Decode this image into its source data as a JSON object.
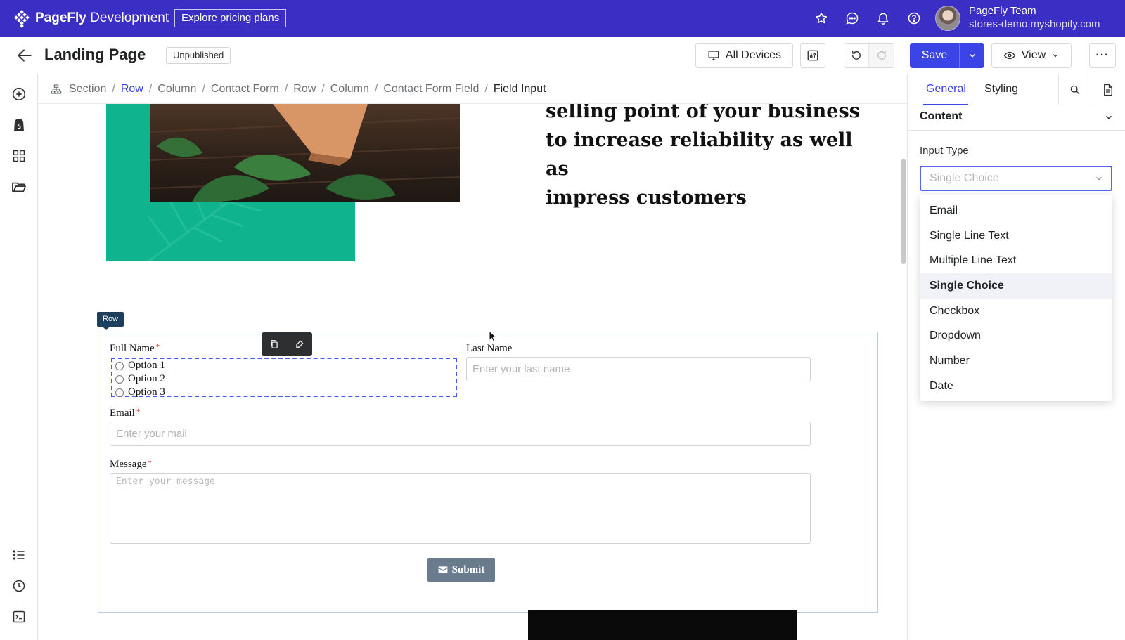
{
  "topbar": {
    "brand_strong": "PageFly",
    "brand_rest": " Development",
    "pricing_label": "Explore pricing plans",
    "user_name": "PageFly Team",
    "store_url": "stores-demo.myshopify.com"
  },
  "toolbar": {
    "page_title": "Landing Page",
    "status": "Unpublished",
    "devices_label": "All Devices",
    "save_label": "Save",
    "view_label": "View",
    "more_label": "···"
  },
  "breadcrumb": [
    "Section",
    "Row",
    "Column",
    "Contact Form",
    "Row",
    "Column",
    "Contact Form Field",
    "Field Input"
  ],
  "canvas": {
    "headline_lines": [
      "selling point of your business",
      "to increase reliability as well as",
      "impress customers"
    ],
    "row_tag": "Row",
    "form": {
      "full_name_label": "Full Name",
      "last_name_label": "Last Name",
      "last_name_placeholder": "Enter your last name",
      "options": [
        "Option 1",
        "Option 2",
        "Option 3"
      ],
      "email_label": "Email",
      "email_placeholder": "Enter your mail",
      "message_label": "Message",
      "message_placeholder": "Enter your message",
      "required_mark": "*",
      "submit_label": "Submit"
    }
  },
  "panel": {
    "tabs": [
      "General",
      "Styling"
    ],
    "section_title": "Content",
    "input_type_label": "Input Type",
    "input_type_value": "Single Choice",
    "options": [
      "Email",
      "Single Line Text",
      "Multiple Line Text",
      "Single Choice",
      "Checkbox",
      "Dropdown",
      "Number",
      "Date"
    ]
  },
  "colors": {
    "topbar": "#3b2ec4",
    "accent": "#3b44e6",
    "green_block": "#0fb38d",
    "row_tag": "#1c3f5d",
    "submit_button": "#6b7b8e"
  },
  "icons": {
    "topbar": [
      "star-icon",
      "chat-icon",
      "bell-icon",
      "help-icon"
    ],
    "left_rail": [
      "add-icon",
      "shopify-icon",
      "grid-icon",
      "folder-icon",
      "list-icon",
      "clock-icon",
      "terminal-icon"
    ]
  }
}
